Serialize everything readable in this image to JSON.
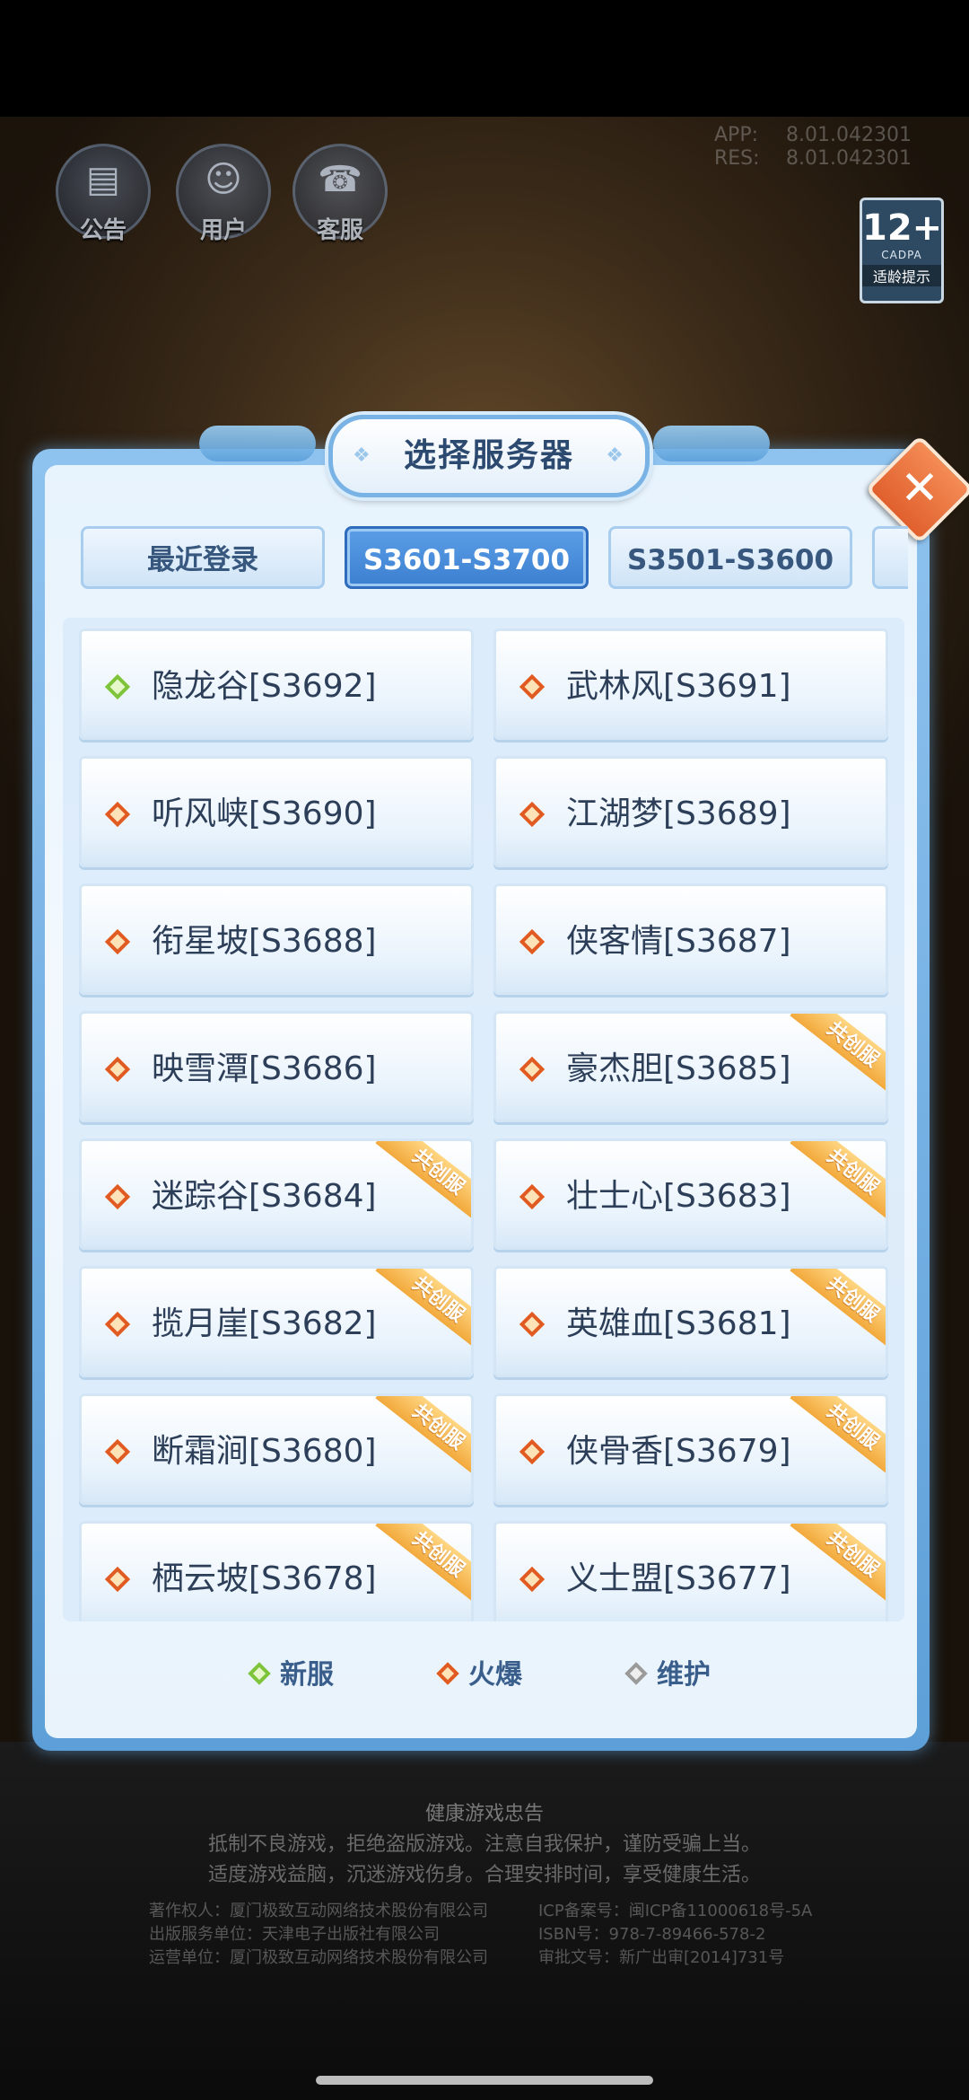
{
  "header": {
    "icons": [
      {
        "label": "公告",
        "icon": "notice-icon"
      },
      {
        "label": "用户",
        "icon": "user-icon"
      },
      {
        "label": "客服",
        "icon": "support-icon"
      }
    ],
    "version": {
      "app_key": "APP:",
      "app_value": "8.01.042301",
      "res_key": "RES:",
      "res_value": "8.01.042301"
    },
    "age_badge": {
      "rating": "12+",
      "org": "CADPA",
      "note": "适龄提示"
    }
  },
  "dialog": {
    "title": "选择服务器",
    "close_symbol": "✕",
    "tabs": [
      {
        "label": "最近登录",
        "active": false
      },
      {
        "label": "S3601-S3700",
        "active": true
      },
      {
        "label": "S3501-S3600",
        "active": false
      }
    ],
    "servers": [
      {
        "name": "隐龙谷[S3692]",
        "status": "new",
        "badge": ""
      },
      {
        "name": "武林风[S3691]",
        "status": "hot",
        "badge": ""
      },
      {
        "name": "听风峡[S3690]",
        "status": "hot",
        "badge": ""
      },
      {
        "name": "江湖梦[S3689]",
        "status": "hot",
        "badge": ""
      },
      {
        "name": "衔星坡[S3688]",
        "status": "hot",
        "badge": ""
      },
      {
        "name": "侠客情[S3687]",
        "status": "hot",
        "badge": ""
      },
      {
        "name": "映雪潭[S3686]",
        "status": "hot",
        "badge": ""
      },
      {
        "name": "豪杰胆[S3685]",
        "status": "hot",
        "badge": "共创服"
      },
      {
        "name": "迷踪谷[S3684]",
        "status": "hot",
        "badge": "共创服"
      },
      {
        "name": "壮士心[S3683]",
        "status": "hot",
        "badge": "共创服"
      },
      {
        "name": "揽月崖[S3682]",
        "status": "hot",
        "badge": "共创服"
      },
      {
        "name": "英雄血[S3681]",
        "status": "hot",
        "badge": "共创服"
      },
      {
        "name": "断霜涧[S3680]",
        "status": "hot",
        "badge": "共创服"
      },
      {
        "name": "侠骨香[S3679]",
        "status": "hot",
        "badge": "共创服"
      },
      {
        "name": "栖云坡[S3678]",
        "status": "hot",
        "badge": "共创服"
      },
      {
        "name": "义士盟[S3677]",
        "status": "hot",
        "badge": "共创服"
      }
    ],
    "legend": [
      {
        "label": "新服",
        "color": "#7ec43a"
      },
      {
        "label": "火爆",
        "color": "#e05a22"
      },
      {
        "label": "维护",
        "color": "#9a9a9a"
      }
    ]
  },
  "footer": {
    "title": "健康游戏忠告",
    "lines": [
      "抵制不良游戏，拒绝盗版游戏。注意自我保护，谨防受骗上当。",
      "适度游戏益脑，沉迷游戏伤身。合理安排时间，享受健康生活。"
    ],
    "credits_left": [
      "著作权人：厦门极致互动网络技术股份有限公司",
      "出版服务单位：天津电子出版社有限公司",
      "运营单位：厦门极致互动网络技术股份有限公司"
    ],
    "credits_right": [
      "ICP备案号：闽ICP备11000618号-5A",
      "ISBN号：978-7-89466-578-2",
      "审批文号：新广出审[2014]731号"
    ]
  },
  "colors": {
    "hot": "#e05a22",
    "new": "#7ec43a",
    "maintenance": "#9a9a9a",
    "accent": "#3b7fd0"
  }
}
